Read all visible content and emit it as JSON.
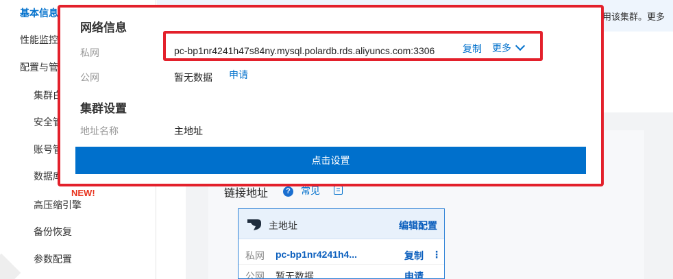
{
  "sidebar": {
    "items": [
      {
        "label": "基本信息",
        "active": true
      },
      {
        "label": "性能监控"
      },
      {
        "label": "配置与管理"
      },
      {
        "label": "集群白名单"
      },
      {
        "label": "安全管理"
      },
      {
        "label": "账号管理"
      },
      {
        "label": "数据库管理"
      },
      {
        "label": "高压缩引擎"
      },
      {
        "label": "备份恢复"
      },
      {
        "label": "参数配置"
      }
    ],
    "new_badge": "NEW!"
  },
  "banner": {
    "text": "用该集群。更多"
  },
  "connection": {
    "title": "链接地址",
    "help_icon": "question-icon",
    "faq_label": "常见",
    "faq_icon": "document-icon"
  },
  "card": {
    "title": "主地址",
    "edit_label": "编辑配置",
    "private_label": "私网",
    "private_value": "pc-bp1nr4241h4...",
    "copy_label": "复制",
    "kebab": "⋮",
    "public_label": "公网",
    "public_value": "暂无数据",
    "apply_label": "申请"
  },
  "popup": {
    "network_title": "网络信息",
    "private_label": "私网",
    "private_address": "pc-bp1nr4241h47s84ny.mysql.polardb.rds.aliyuncs.com:3306",
    "copy_label": "复制",
    "more_label": "更多",
    "public_label": "公网",
    "public_value": "暂无数据",
    "apply_label": "申请",
    "cluster_title": "集群设置",
    "address_name_label": "地址名称",
    "address_name_value": "主地址",
    "set_button": "点击设置"
  },
  "colors": {
    "accent": "#0070cc",
    "highlight": "#e3202b",
    "new_badge": "#e8321c"
  }
}
